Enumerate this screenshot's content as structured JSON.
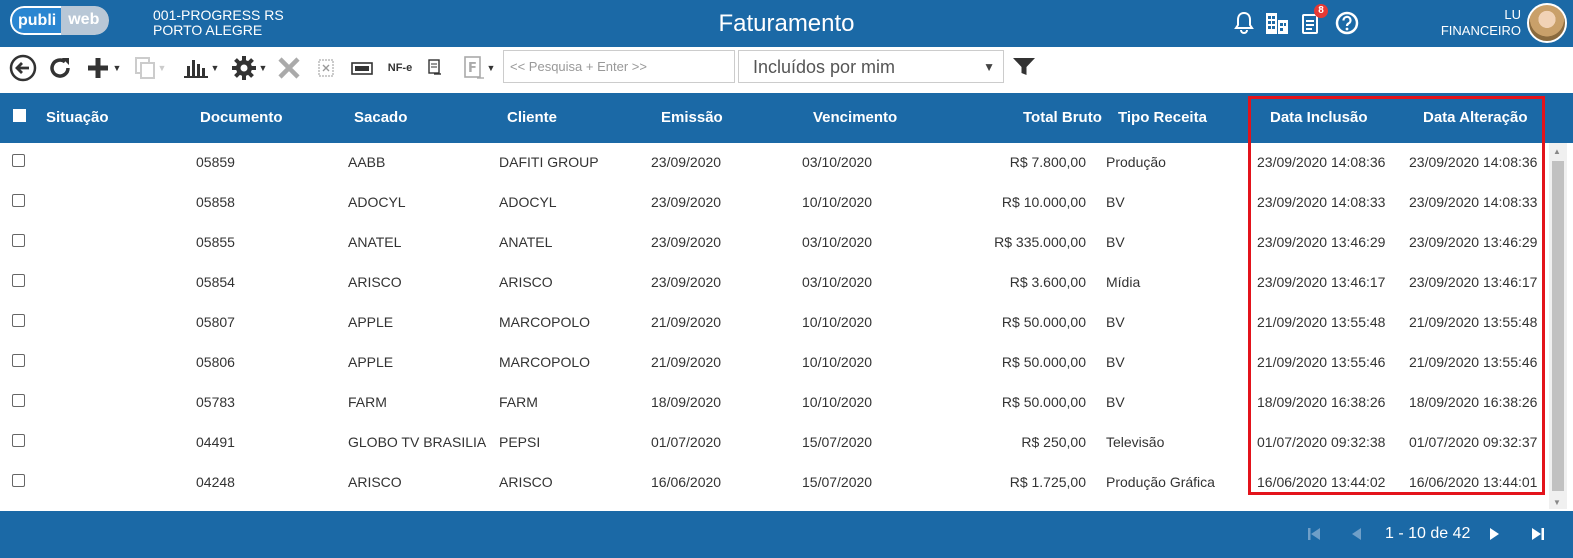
{
  "header": {
    "logo_left": "publi",
    "logo_right": "web",
    "company_line1": "001-PROGRESS RS",
    "company_line2": "PORTO ALEGRE",
    "title": "Faturamento",
    "notification_count": "8",
    "user_name": "LU",
    "user_role": "FINANCEIRO"
  },
  "toolbar": {
    "nfe_label": "NF-e",
    "search_placeholder": "<< Pesquisa + Enter >>",
    "filter_select_value": "Incluídos por mim"
  },
  "table": {
    "columns": {
      "situacao": "Situação",
      "documento": "Documento",
      "sacado": "Sacado",
      "cliente": "Cliente",
      "emissao": "Emissão",
      "vencimento": "Vencimento",
      "total_bruto": "Total Bruto",
      "tipo_receita": "Tipo Receita",
      "data_inclusao": "Data Inclusão",
      "data_alteracao": "Data Alteração"
    },
    "rows": [
      {
        "documento": "05859",
        "sacado": "AABB",
        "cliente": "DAFITI GROUP",
        "emissao": "23/09/2020",
        "vencimento": "03/10/2020",
        "total": "R$ 7.800,00",
        "tipo": "Produção",
        "inclusao": "23/09/2020 14:08:36",
        "alteracao": "23/09/2020 14:08:36"
      },
      {
        "documento": "05858",
        "sacado": "ADOCYL",
        "cliente": "ADOCYL",
        "emissao": "23/09/2020",
        "vencimento": "10/10/2020",
        "total": "R$ 10.000,00",
        "tipo": "BV",
        "inclusao": "23/09/2020 14:08:33",
        "alteracao": "23/09/2020 14:08:33"
      },
      {
        "documento": "05855",
        "sacado": "ANATEL",
        "cliente": "ANATEL",
        "emissao": "23/09/2020",
        "vencimento": "03/10/2020",
        "total": "R$ 335.000,00",
        "tipo": "BV",
        "inclusao": "23/09/2020 13:46:29",
        "alteracao": "23/09/2020 13:46:29"
      },
      {
        "documento": "05854",
        "sacado": "ARISCO",
        "cliente": "ARISCO",
        "emissao": "23/09/2020",
        "vencimento": "03/10/2020",
        "total": "R$ 3.600,00",
        "tipo": "Mídia",
        "inclusao": "23/09/2020 13:46:17",
        "alteracao": "23/09/2020 13:46:17"
      },
      {
        "documento": "05807",
        "sacado": "APPLE",
        "cliente": "MARCOPOLO",
        "emissao": "21/09/2020",
        "vencimento": "10/10/2020",
        "total": "R$ 50.000,00",
        "tipo": "BV",
        "inclusao": "21/09/2020 13:55:48",
        "alteracao": "21/09/2020 13:55:48"
      },
      {
        "documento": "05806",
        "sacado": "APPLE",
        "cliente": "MARCOPOLO",
        "emissao": "21/09/2020",
        "vencimento": "10/10/2020",
        "total": "R$ 50.000,00",
        "tipo": "BV",
        "inclusao": "21/09/2020 13:55:46",
        "alteracao": "21/09/2020 13:55:46"
      },
      {
        "documento": "05783",
        "sacado": "FARM",
        "cliente": "FARM",
        "emissao": "18/09/2020",
        "vencimento": "10/10/2020",
        "total": "R$ 50.000,00",
        "tipo": "BV",
        "inclusao": "18/09/2020 16:38:26",
        "alteracao": "18/09/2020 16:38:26"
      },
      {
        "documento": "04491",
        "sacado": "GLOBO TV BRASILIA",
        "cliente": "PEPSI",
        "emissao": "01/07/2020",
        "vencimento": "15/07/2020",
        "total": "R$ 250,00",
        "tipo": "Televisão",
        "inclusao": "01/07/2020 09:32:38",
        "alteracao": "01/07/2020 09:32:37"
      },
      {
        "documento": "04248",
        "sacado": "ARISCO",
        "cliente": "ARISCO",
        "emissao": "16/06/2020",
        "vencimento": "15/07/2020",
        "total": "R$ 1.725,00",
        "tipo": "Produção Gráfica",
        "inclusao": "16/06/2020 13:44:02",
        "alteracao": "16/06/2020 13:44:01"
      }
    ]
  },
  "pagination": {
    "info": "1 - 10 de 42"
  },
  "colors": {
    "primary": "#1b69a6",
    "highlight": "#e3131b",
    "badge": "#e53935"
  }
}
